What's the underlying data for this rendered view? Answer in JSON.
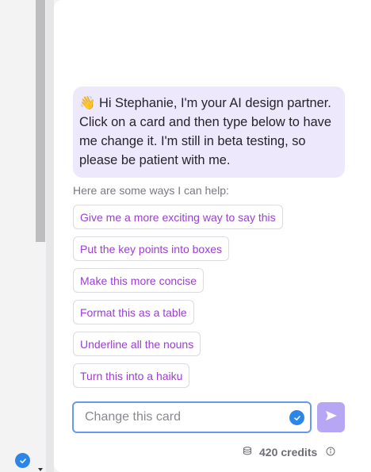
{
  "assistant": {
    "greeting_emoji": "👋",
    "greeting_text": "Hi Stephanie, I'm your AI design partner. Click on a card and then type below to have me change it. I'm still in beta testing, so please be patient with me.",
    "help_label": "Here are some ways I can help:",
    "suggestions": [
      "Give me a more exciting way to say this",
      "Put the key points into boxes",
      "Make this more concise",
      "Format this as a table",
      "Underline all the nouns",
      "Turn this into a haiku"
    ]
  },
  "composer": {
    "placeholder": "Change this card",
    "value": ""
  },
  "credits": {
    "count": "420",
    "label": "credits"
  },
  "colors": {
    "accent": "#9a3fd0",
    "bubble": "#eee8fd",
    "send": "#b7a6f3",
    "check": "#2b86e8"
  },
  "icons": {
    "send": "send-arrow-icon",
    "credits": "coins-stack-icon",
    "info": "info-icon",
    "check": "check-circle-icon"
  }
}
